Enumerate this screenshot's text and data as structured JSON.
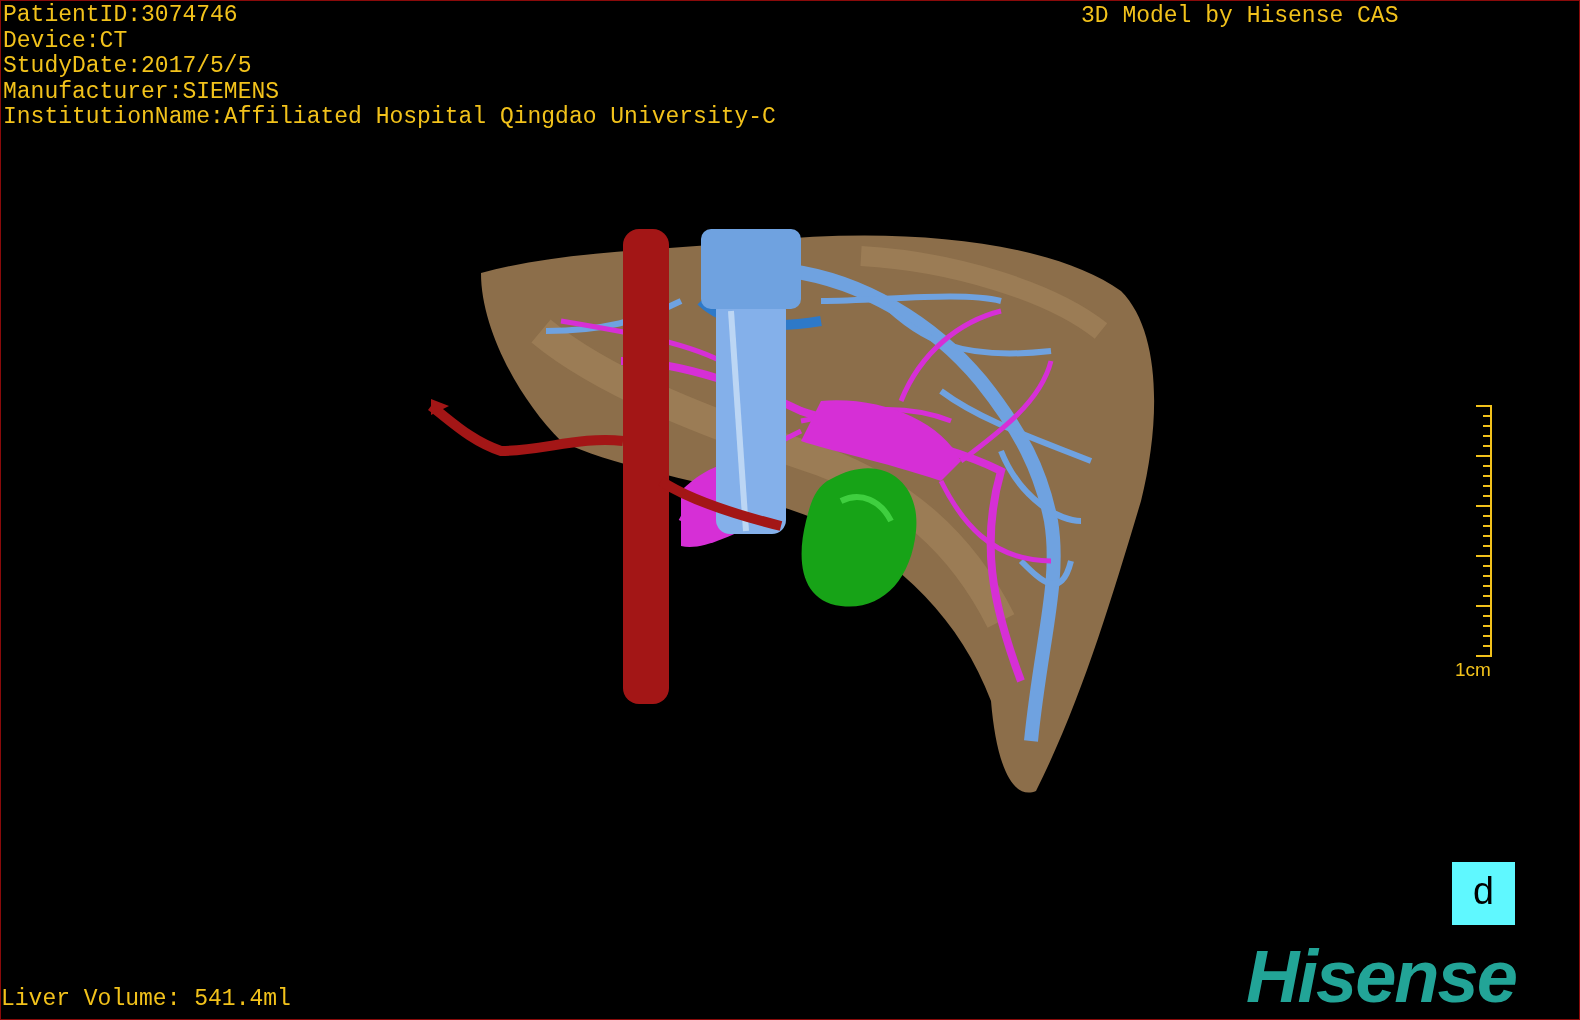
{
  "info_lines": [
    "PatientID:3074746",
    "Device:CT",
    "StudyDate:2017/5/5",
    "Manufacturer:SIEMENS",
    "InstitutionName:Affiliated Hospital Qingdao University-C"
  ],
  "title": "3D Model by Hisense CAS",
  "scale_bar": {
    "label": "1cm"
  },
  "orientation_cube": {
    "label": "d"
  },
  "logo": "Hisense",
  "liver_volume": "Liver Volume: 541.4ml"
}
